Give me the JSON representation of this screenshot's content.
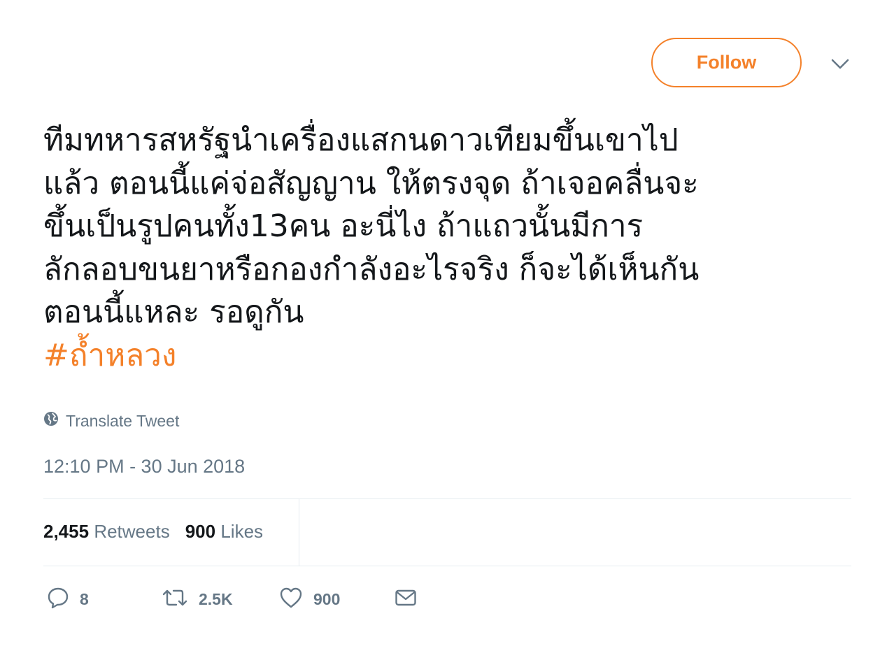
{
  "header": {
    "follow_label": "Follow",
    "caret_icon": "chevron-down-icon"
  },
  "tweet": {
    "lines": [
      "ทีมทหารสหรัฐนำเครื่องแสกนดาวเทียมขึ้นเขาไป",
      "แล้ว ตอนนี้แค่จ่อสัญญาน ให้ตรงจุด ถ้าเจอคลื่นจะ",
      "ขึ้นเป็นรูปคนทั้ง13คน อะนี่ไง ถ้าแถวนั้นมีการ",
      "ลักลอบขนยาหรือกองกำลังอะไรจริง ก็จะได้เห็นกัน",
      "ตอนนี้แหละ รอดูกัน"
    ],
    "hashtag": "#ถ้ำหลวง",
    "translate_label": "Translate Tweet",
    "translate_icon": "globe-icon",
    "timestamp": "12:10 PM - 30 Jun 2018"
  },
  "stats": {
    "retweets_count": "2,455",
    "retweets_label": "Retweets",
    "likes_count": "900",
    "likes_label": "Likes"
  },
  "actions": {
    "reply_count": "8",
    "retweet_count": "2.5K",
    "like_count": "900",
    "icons": [
      "reply-icon",
      "retweet-icon",
      "like-icon",
      "message-icon"
    ]
  },
  "colors": {
    "accent": "#f4812a",
    "text": "#14171a",
    "secondary": "#657786",
    "divider": "#e6ecf0"
  }
}
